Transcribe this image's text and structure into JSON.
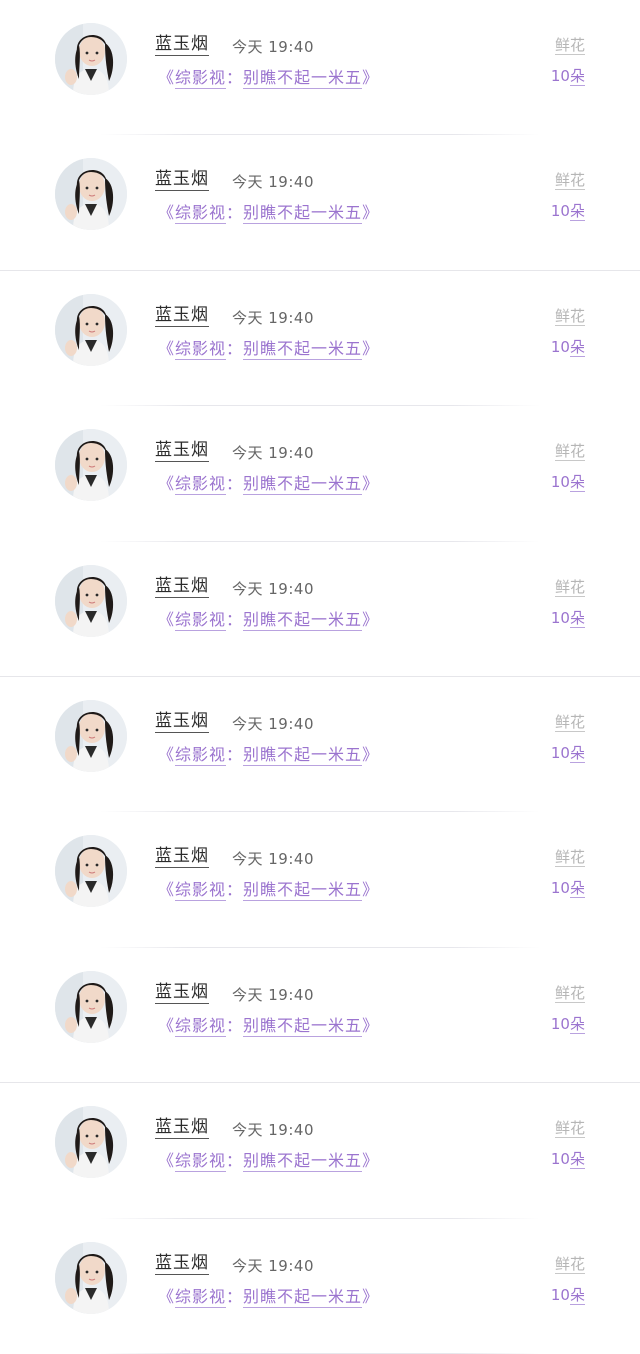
{
  "feed": {
    "items": [
      {
        "name": "蓝玉烟",
        "time": "今天 19:40",
        "title_open": "《",
        "title_category": "综影视",
        "title_sep": "：",
        "title_name": "别瞧不起一米五",
        "title_close": "》",
        "flowers_label": "鲜花",
        "flowers_number": "10",
        "flowers_unit": "朵"
      },
      {
        "name": "蓝玉烟",
        "time": "今天 19:40",
        "title_open": "《",
        "title_category": "综影视",
        "title_sep": "：",
        "title_name": "别瞧不起一米五",
        "title_close": "》",
        "flowers_label": "鲜花",
        "flowers_number": "10",
        "flowers_unit": "朵"
      },
      {
        "name": "蓝玉烟",
        "time": "今天 19:40",
        "title_open": "《",
        "title_category": "综影视",
        "title_sep": "：",
        "title_name": "别瞧不起一米五",
        "title_close": "》",
        "flowers_label": "鲜花",
        "flowers_number": "10",
        "flowers_unit": "朵"
      },
      {
        "name": "蓝玉烟",
        "time": "今天 19:40",
        "title_open": "《",
        "title_category": "综影视",
        "title_sep": "：",
        "title_name": "别瞧不起一米五",
        "title_close": "》",
        "flowers_label": "鲜花",
        "flowers_number": "10",
        "flowers_unit": "朵"
      },
      {
        "name": "蓝玉烟",
        "time": "今天 19:40",
        "title_open": "《",
        "title_category": "综影视",
        "title_sep": "：",
        "title_name": "别瞧不起一米五",
        "title_close": "》",
        "flowers_label": "鲜花",
        "flowers_number": "10",
        "flowers_unit": "朵"
      },
      {
        "name": "蓝玉烟",
        "time": "今天 19:40",
        "title_open": "《",
        "title_category": "综影视",
        "title_sep": "：",
        "title_name": "别瞧不起一米五",
        "title_close": "》",
        "flowers_label": "鲜花",
        "flowers_number": "10",
        "flowers_unit": "朵"
      },
      {
        "name": "蓝玉烟",
        "time": "今天 19:40",
        "title_open": "《",
        "title_category": "综影视",
        "title_sep": "：",
        "title_name": "别瞧不起一米五",
        "title_close": "》",
        "flowers_label": "鲜花",
        "flowers_number": "10",
        "flowers_unit": "朵"
      },
      {
        "name": "蓝玉烟",
        "time": "今天 19:40",
        "title_open": "《",
        "title_category": "综影视",
        "title_sep": "：",
        "title_name": "别瞧不起一米五",
        "title_close": "》",
        "flowers_label": "鲜花",
        "flowers_number": "10",
        "flowers_unit": "朵"
      },
      {
        "name": "蓝玉烟",
        "time": "今天 19:40",
        "title_open": "《",
        "title_category": "综影视",
        "title_sep": "：",
        "title_name": "别瞧不起一米五",
        "title_close": "》",
        "flowers_label": "鲜花",
        "flowers_number": "10",
        "flowers_unit": "朵"
      },
      {
        "name": "蓝玉烟",
        "time": "今天 19:40",
        "title_open": "《",
        "title_category": "综影视",
        "title_sep": "：",
        "title_name": "别瞧不起一米五",
        "title_close": "》",
        "flowers_label": "鲜花",
        "flowers_number": "10",
        "flowers_unit": "朵"
      }
    ]
  },
  "colors": {
    "accent_purple": "#9b74cf",
    "name_text": "#2b2b2b",
    "muted_text": "#b6b6b6"
  },
  "icons": {
    "avatar": "user-avatar-photo"
  }
}
